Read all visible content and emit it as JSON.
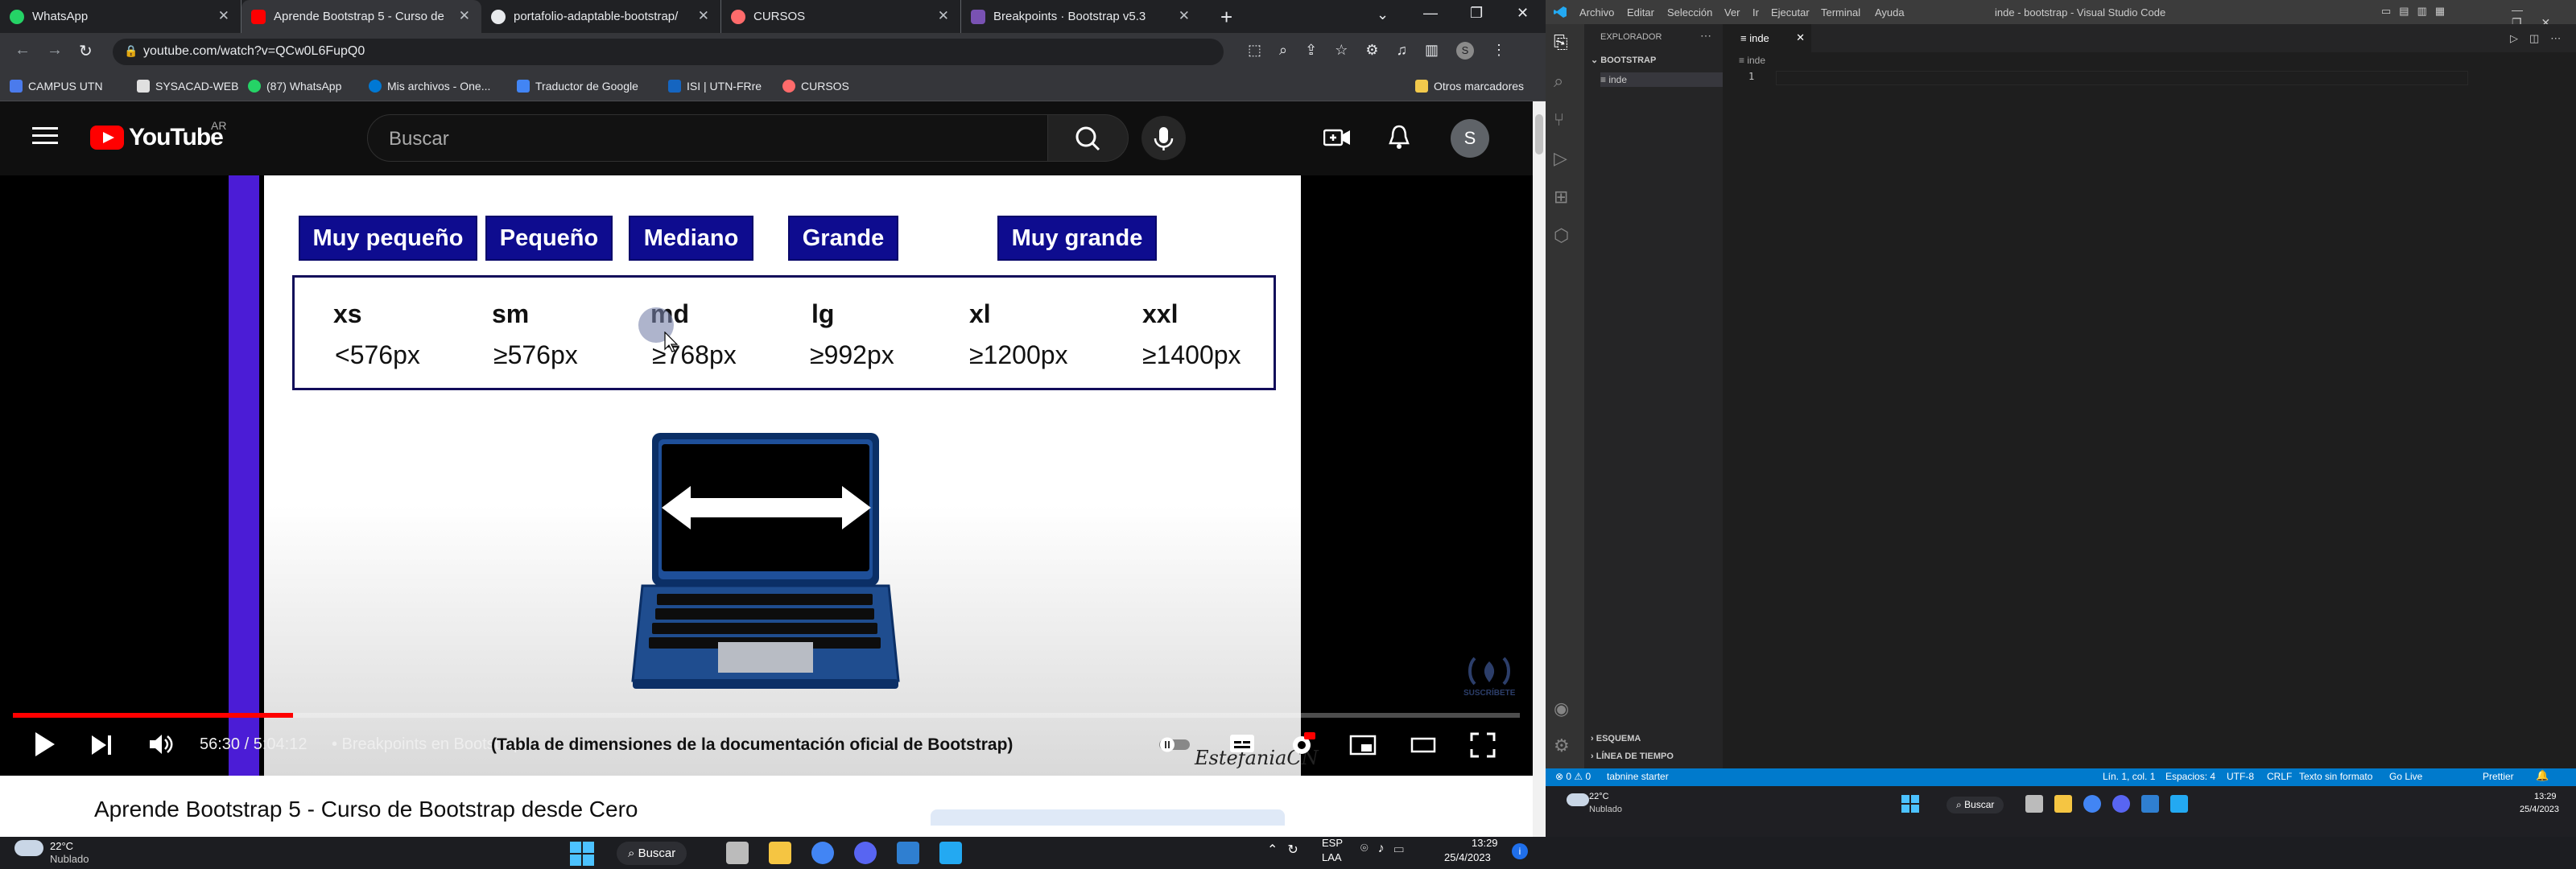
{
  "browser": {
    "tabs": [
      {
        "label": "WhatsApp",
        "color": "#25d366"
      },
      {
        "label": "Aprende Bootstrap 5 - Curso de",
        "color": "#ff0000"
      },
      {
        "label": "portafolio-adaptable-bootstrap/",
        "color": "#e8eaed"
      },
      {
        "label": "CURSOS",
        "color": "#ff6b6b"
      },
      {
        "label": "Breakpoints · Bootstrap v5.3",
        "color": "#7952b3"
      }
    ],
    "url": "youtube.com/watch?v=QCw0L6FupQ0",
    "bookmarks": [
      {
        "label": "CAMPUS UTN",
        "color": "#4b7bec"
      },
      {
        "label": "SYSACAD-WEB",
        "color": "#e0e0e0"
      },
      {
        "label": "(87) WhatsApp",
        "color": "#25d366"
      },
      {
        "label": "Mis archivos - One...",
        "color": "#0078d4"
      },
      {
        "label": "Traductor de Google",
        "color": "#4285f4"
      },
      {
        "label": "ISI | UTN-FRre",
        "color": "#1565c0"
      },
      {
        "label": "CURSOS",
        "color": "#ff6b6b"
      }
    ],
    "other_bookmarks": "Otros marcadores"
  },
  "youtube": {
    "logo_text": "YouTube",
    "country": "AR",
    "search_placeholder": "Buscar",
    "avatar_letter": "S",
    "video_title": "Aprende Bootstrap 5 - Curso de Bootstrap desde Cero",
    "player": {
      "time": "56:30 / 5:04:12",
      "chapter": "• Breakpoints en Bootstrap",
      "subtitle": "(Tabla de dimensiones de la documentación oficial de Bootstrap)",
      "watermark": "SUSCRÍBETE",
      "signature": "EstefaniaCN",
      "progress": 0.186
    },
    "slide": {
      "labels": [
        "Muy pequeño",
        "Pequeño",
        "Mediano",
        "Grande",
        "Muy grande"
      ],
      "keys": [
        "xs",
        "sm",
        "md",
        "lg",
        "xl",
        "xxl"
      ],
      "values": [
        "<576px",
        "≥576px",
        "≥768px",
        "≥992px",
        "≥1200px",
        "≥1400px"
      ]
    }
  },
  "vscode": {
    "menu": [
      "Archivo",
      "Editar",
      "Selección",
      "Ver",
      "Ir",
      "Ejecutar",
      "Terminal",
      "Ayuda"
    ],
    "title": "inde - bootstrap - Visual Studio Code",
    "explorer_title": "EXPLORADOR",
    "folder": "BOOTSTRAP",
    "file": "inde",
    "tab": "inde",
    "breadcrumb": "inde",
    "line_number": "1",
    "outline": "ESQUEMA",
    "timeline": "LÍNEA DE TIEMPO",
    "status_left": [
      "⊗ 0 ⚠ 0",
      "tabnine starter"
    ],
    "status_right": [
      "Lín. 1, col. 1",
      "Espacios: 4",
      "UTF-8",
      "CRLF",
      "Texto sin formato",
      "Go Live",
      "Prettier"
    ]
  },
  "taskbar": {
    "temp": "22°C",
    "weather": "Nublado",
    "search": "Buscar",
    "lang": "ESP",
    "lang2": "LAA",
    "time": "13:29",
    "date": "25/4/2023"
  },
  "taskbar2": {
    "temp": "22°C",
    "weather": "Nublado",
    "search": "Buscar",
    "time": "13:29",
    "date": "25/4/2023"
  }
}
